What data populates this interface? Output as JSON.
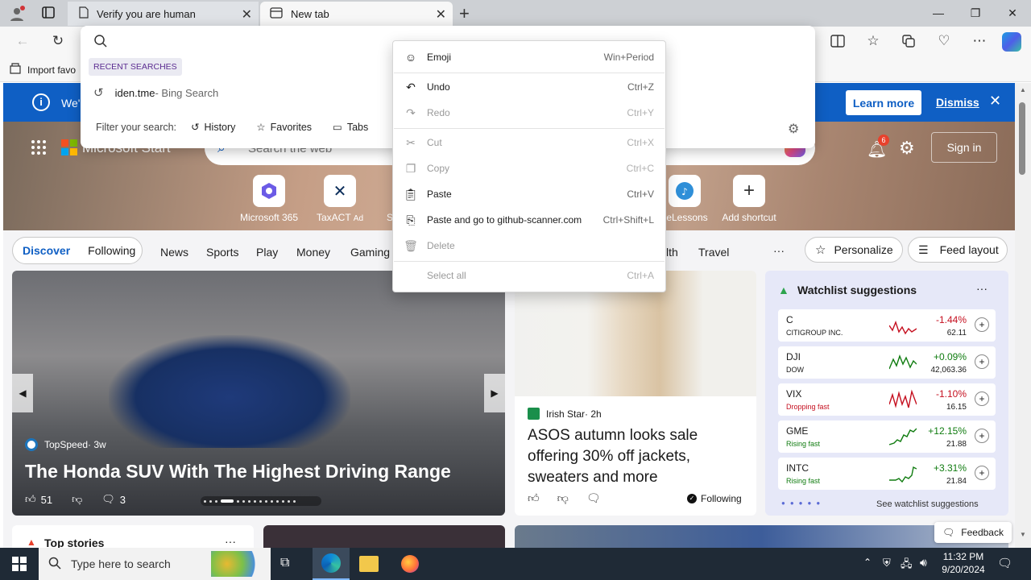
{
  "browser": {
    "tabs": [
      {
        "title": "Verify you are human",
        "active": false
      },
      {
        "title": "New tab",
        "active": true
      }
    ],
    "favorites_bar": {
      "import_label": "Import favo"
    }
  },
  "omnibox": {
    "section_label": "RECENT SEARCHES",
    "recent": {
      "query": "iden.tme",
      "suffix": " - Bing Search"
    },
    "filter_label": "Filter your search:",
    "filters": [
      "History",
      "Favorites",
      "Tabs"
    ]
  },
  "context_menu": {
    "items": [
      {
        "label": "Emoji",
        "shortcut": "Win+Period",
        "disabled": false,
        "icon": "emoji-icon"
      },
      {
        "label": "Undo",
        "shortcut": "Ctrl+Z",
        "disabled": false,
        "icon": "undo-icon"
      },
      {
        "label": "Redo",
        "shortcut": "Ctrl+Y",
        "disabled": true,
        "icon": "redo-icon"
      },
      {
        "label": "Cut",
        "shortcut": "Ctrl+X",
        "disabled": true,
        "icon": "cut-icon"
      },
      {
        "label": "Copy",
        "shortcut": "Ctrl+C",
        "disabled": true,
        "icon": "copy-icon"
      },
      {
        "label": "Paste",
        "shortcut": "Ctrl+V",
        "disabled": false,
        "icon": "paste-icon"
      },
      {
        "label": "Paste and go to github-scanner.com",
        "shortcut": "Ctrl+Shift+L",
        "disabled": false,
        "icon": "paste-go-icon"
      },
      {
        "label": "Delete",
        "shortcut": "",
        "disabled": true,
        "icon": "delete-icon"
      },
      {
        "label": "Select all",
        "shortcut": "Ctrl+A",
        "disabled": true,
        "icon": ""
      }
    ]
  },
  "infobar": {
    "text": "We'",
    "learn_more": "Learn more",
    "dismiss": "Dismiss"
  },
  "header": {
    "brand": "Microsoft Start",
    "search_placeholder": "Search the web",
    "notifications": "6",
    "sign_in": "Sign in"
  },
  "shortcuts": [
    {
      "label": "Microsoft 365"
    },
    {
      "label": "TaxACT",
      "ad": "Ad"
    },
    {
      "label": "S"
    },
    {
      "label": "ceLessons"
    },
    {
      "label": "Add shortcut"
    }
  ],
  "nav": {
    "tabs": [
      "Discover",
      "Following"
    ],
    "items": [
      "News",
      "Sports",
      "Play",
      "Money",
      "Gaming",
      "lth",
      "Travel"
    ],
    "more": "···",
    "personalize": "Personalize",
    "feed_layout": "Feed layout"
  },
  "hero_story": {
    "source": "TopSpeed",
    "age": " · 3w",
    "headline": "The Honda SUV With The Highest Driving Range",
    "likes": "51",
    "comments": "3"
  },
  "story2": {
    "source": "Irish Star",
    "age": " · 2h",
    "headline": "ASOS autumn looks sale offering 30% off jackets, sweaters and more",
    "following": "Following"
  },
  "watchlist": {
    "title": "Watchlist suggestions",
    "more": "···",
    "rows": [
      {
        "symbol": "C",
        "sub": "CITIGROUP INC.",
        "change": "-1.44%",
        "price": "62.11",
        "up": false
      },
      {
        "symbol": "DJI",
        "sub": "DOW",
        "change": "+0.09%",
        "price": "42,063.36",
        "up": true
      },
      {
        "symbol": "VIX",
        "sub": "Dropping fast",
        "change": "-1.10%",
        "price": "16.15",
        "up": false
      },
      {
        "symbol": "GME",
        "sub": "Rising fast",
        "change": "+12.15%",
        "price": "21.88",
        "up": true
      },
      {
        "symbol": "INTC",
        "sub": "Rising fast",
        "change": "+3.31%",
        "price": "21.84",
        "up": true
      }
    ],
    "see_more": "See watchlist suggestions"
  },
  "bottom": {
    "top_stories": "Top stories",
    "feedback": "Feedback"
  },
  "taskbar": {
    "search_placeholder": "Type here to search",
    "time": "11:32 PM",
    "date": "9/20/2024"
  },
  "colors": {
    "accent": "#0f5fc4",
    "up": "#107c10",
    "down": "#c50f1f",
    "purple": "#5c2d91"
  }
}
